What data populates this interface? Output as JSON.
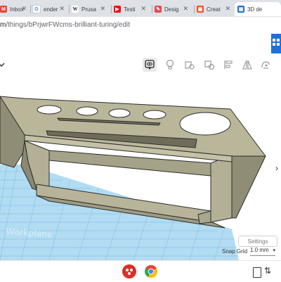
{
  "tabs": [
    {
      "label": "Inbox",
      "icon": "mail-icon",
      "color": "#ea4335"
    },
    {
      "label": "ender",
      "icon": "google-icon",
      "color": "#4285f4"
    },
    {
      "label": "Prusa",
      "icon": "wikipedia-icon",
      "color": "#444444"
    },
    {
      "label": "Testi",
      "icon": "youtube-icon",
      "color": "#ff0000"
    },
    {
      "label": "Desig",
      "icon": "design-icon",
      "color": "#e8484f"
    },
    {
      "label": "Creat",
      "icon": "create-icon",
      "color": "#f4511e"
    },
    {
      "label": "3D de",
      "icon": "tinkercad-icon",
      "color": "#1f6fdc",
      "active": true
    }
  ],
  "address": {
    "host": "m",
    "path": "/things/bPrjwrFWcms-brilliant-turing/edit"
  },
  "workplane_label": "Workplane",
  "settings_label": "Settings",
  "snap_grid": {
    "label": "Snap Grid",
    "value": "1.0 mm"
  },
  "colors": {
    "accent": "#1f6fdc",
    "model_fill": "#b9b69a",
    "model_edge": "#2c2c2c",
    "workplane": "#9fd3ef"
  }
}
